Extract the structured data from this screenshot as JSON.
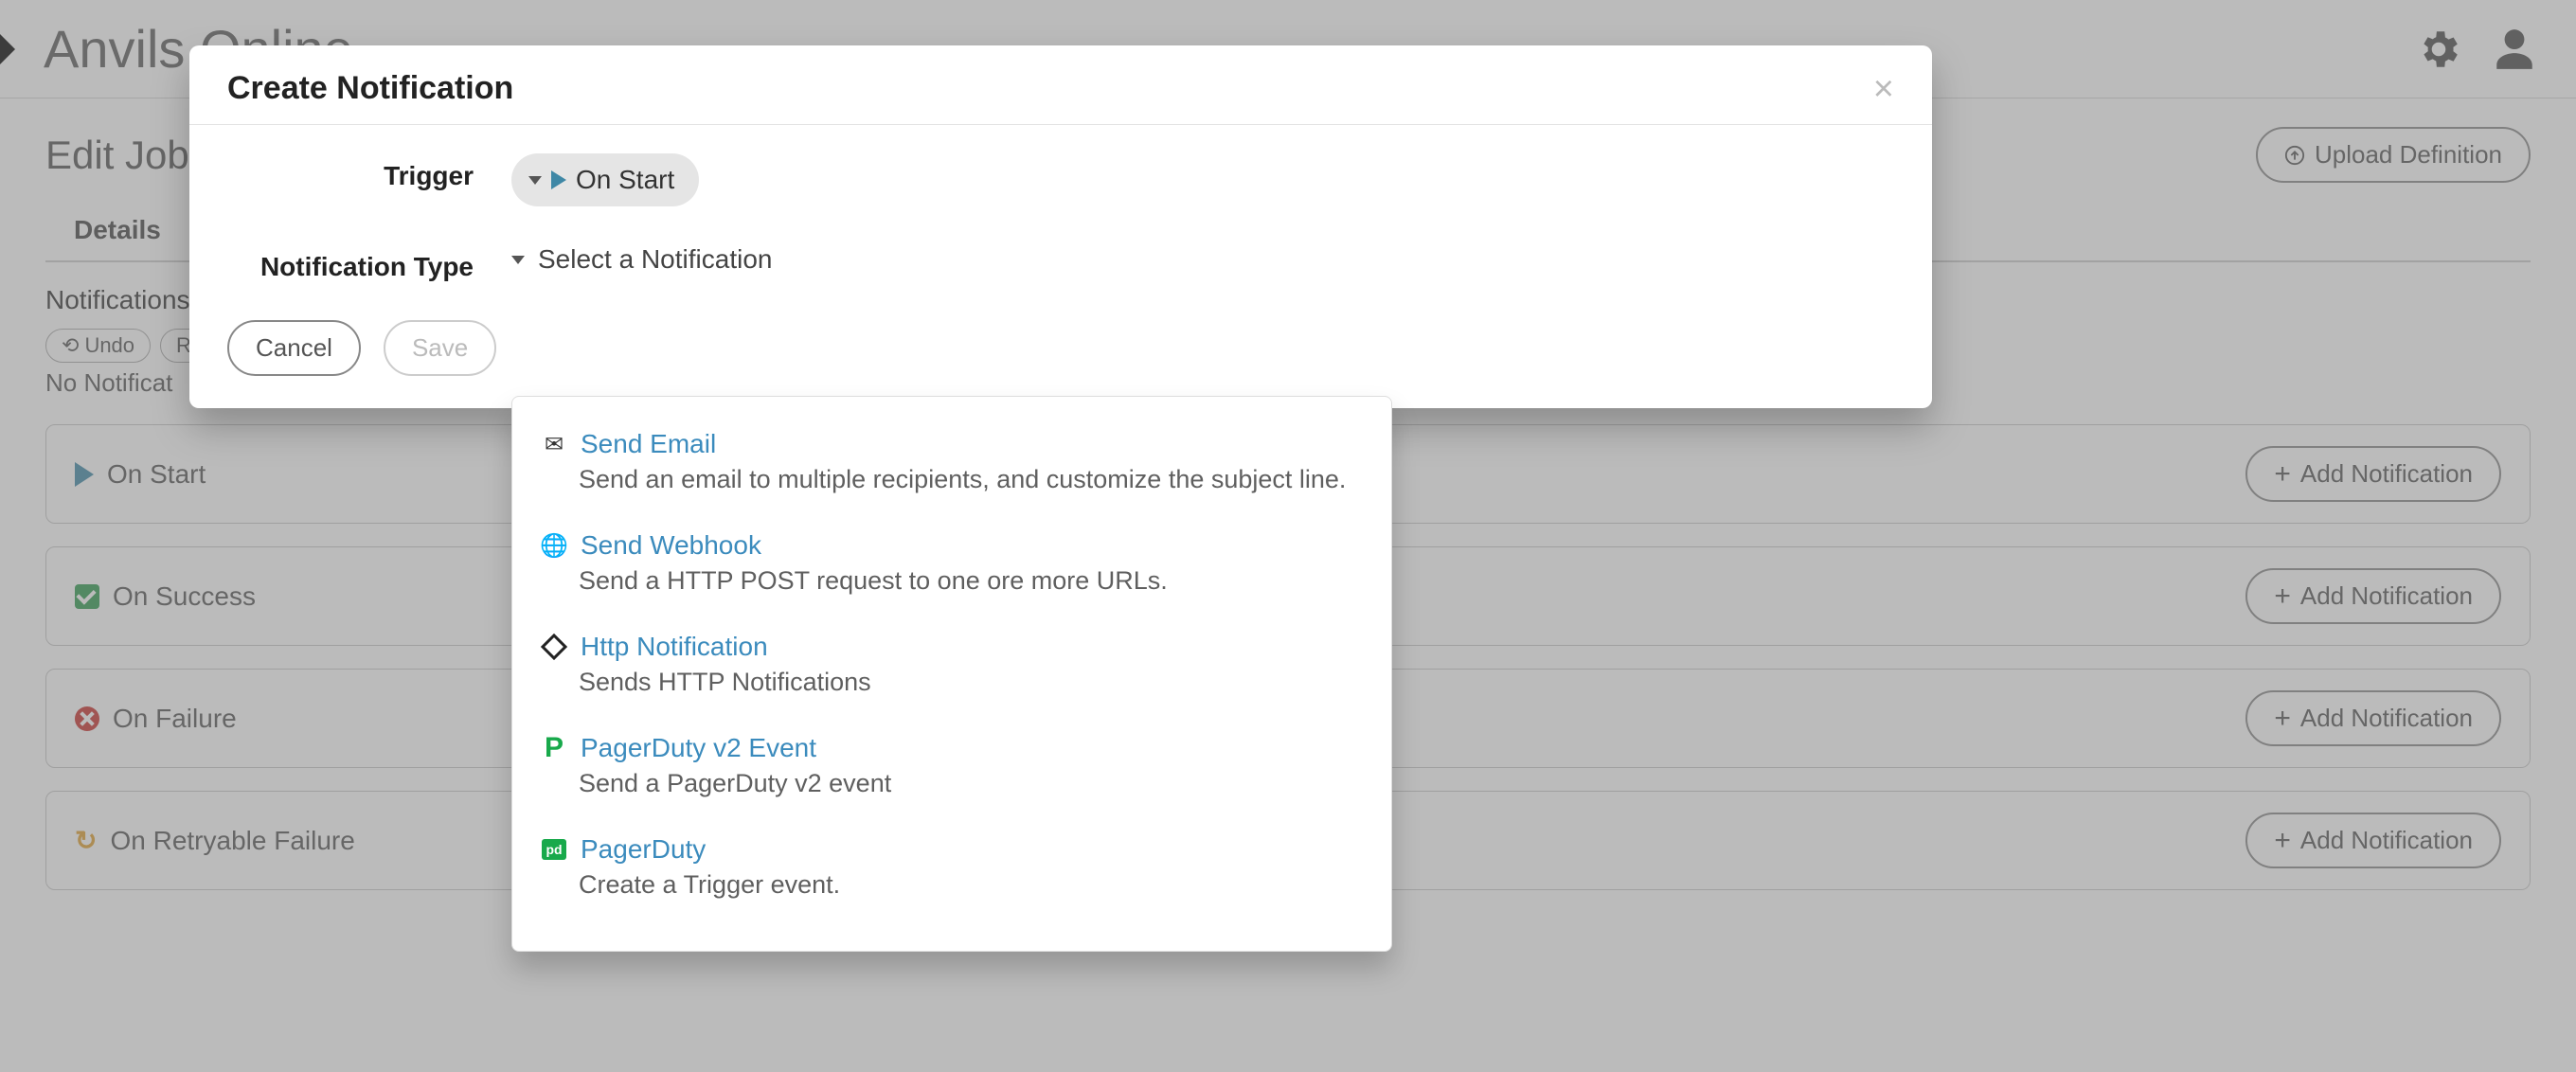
{
  "topbar": {
    "title": "Anvils Online"
  },
  "page": {
    "edit_label": "Edit Job:",
    "upload_btn": "Upload Definition",
    "tab_details": "Details",
    "notifications_title": "Notifications",
    "undo": "Undo",
    "redo": "Re",
    "none_msg": "No Notificat",
    "add_btn": "Add Notification",
    "events": {
      "start": "On Start",
      "success": "On Success",
      "failure": "On Failure",
      "retry": "On Retryable Failure"
    }
  },
  "modal": {
    "title": "Create Notification",
    "trigger_label": "Trigger",
    "trigger_value": "On Start",
    "type_label": "Notification Type",
    "type_placeholder": "Select a Notification",
    "cancel": "Cancel",
    "save": "Save"
  },
  "dropdown": [
    {
      "icon": "envelope",
      "title": "Send Email",
      "desc": "Send an email to multiple recipients, and customize the subject line."
    },
    {
      "icon": "globe",
      "title": "Send Webhook",
      "desc": "Send a HTTP POST request to one ore more URLs."
    },
    {
      "icon": "diamond",
      "title": "Http Notification",
      "desc": "Sends HTTP Notifications"
    },
    {
      "icon": "pd-green",
      "title": "PagerDuty v2 Event",
      "desc": "Send a PagerDuty v2 event"
    },
    {
      "icon": "pd-badge",
      "title": "PagerDuty",
      "desc": "Create a Trigger event."
    }
  ]
}
